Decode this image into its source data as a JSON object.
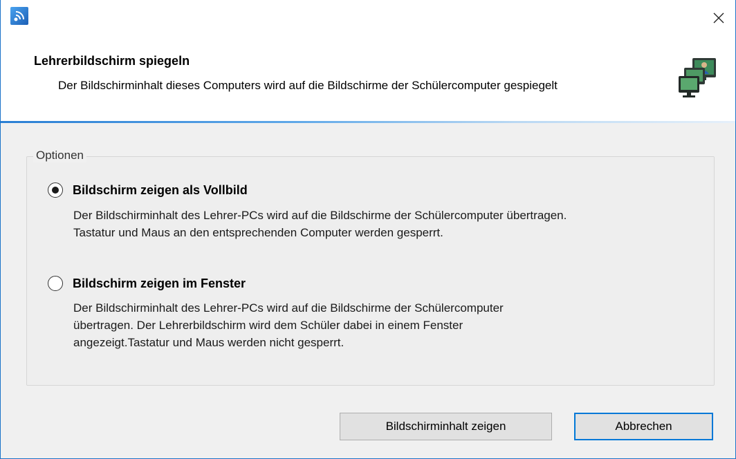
{
  "dialog": {
    "title": "Lehrerbildschirm spiegeln",
    "description": "Der Bildschirminhalt dieses Computers wird auf die Bildschirme der Schülercomputer gespiegelt"
  },
  "options": {
    "group_label": "Optionen",
    "items": [
      {
        "label": "Bildschirm zeigen als Vollbild",
        "selected": true,
        "description_lines": [
          "Der Bildschirminhalt des Lehrer-PCs wird auf die Bildschirme der Schülercomputer übertragen.",
          "Tastatur und Maus an den entsprechenden Computer werden gesperrt."
        ]
      },
      {
        "label": "Bildschirm zeigen im Fenster",
        "selected": false,
        "description_lines": [
          "Der Bildschirminhalt des Lehrer-PCs wird auf die Bildschirme der Schülercomputer",
          "übertragen. Der Lehrerbildschirm wird dem Schüler dabei in einem Fenster",
          "angezeigt.Tastatur und Maus werden nicht gesperrt."
        ]
      }
    ]
  },
  "buttons": {
    "confirm_label": "Bildschirminhalt zeigen",
    "cancel_label": "Abbrechen"
  },
  "colors": {
    "accent": "#0078d7",
    "header_line_start": "#2a7fd4",
    "window_border": "#1a73c9"
  },
  "icons": {
    "app": "broadcast-icon",
    "close": "close-icon",
    "header": "computers-icon"
  }
}
